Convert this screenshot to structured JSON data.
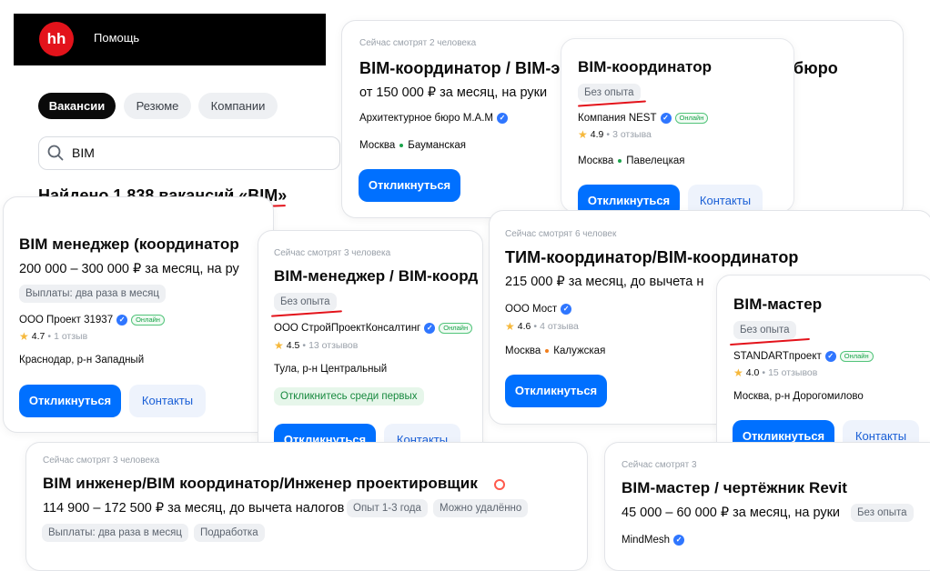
{
  "header": {
    "logo": "hh",
    "help": "Помощь"
  },
  "tabs": [
    {
      "label": "Вакансии"
    },
    {
      "label": "Резюме"
    },
    {
      "label": "Компании"
    }
  ],
  "search": {
    "value": "BIM"
  },
  "found": "Найдено 1 838 вакансий «BIM»",
  "cards": {
    "c1": {
      "viewers": "Сейчас смотрят 2 человека",
      "title": "BIM-координатор / BIM-эн",
      "salary": "от 150 000 ₽ за месяц, на руки",
      "company": "Архитектурное бюро М.А.М",
      "city": "Москва",
      "metro": "Бауманская",
      "apply": "Откликнуться",
      "ghost": "бюро"
    },
    "c2": {
      "title": "BIM-координатор",
      "experience": "Без опыта",
      "company": "Компания NEST",
      "online": "Онлайн",
      "rating": "4.9",
      "reviews": "3 отзыва",
      "city": "Москва",
      "metro": "Павелецкая",
      "apply": "Откликнуться",
      "contacts": "Контакты"
    },
    "c3": {
      "title": "BIM менеджер (координатор",
      "salary": "200 000 – 300 000 ₽ за месяц, на ру",
      "payments": "Выплаты: два раза в месяц",
      "company": "ООО Проект 31937",
      "online": "Онлайн",
      "rating": "4.7",
      "reviews": "1 отзыв",
      "location": "Краснодар, р-н Западный",
      "apply": "Откликнуться",
      "contacts": "Контакты"
    },
    "c4": {
      "viewers": "Сейчас смотрят 3 человека",
      "title": "BIM-менеджер / BIM-коорд",
      "experience": "Без опыта",
      "company": "ООО СтройПроектКонсалтинг",
      "online": "Онлайн",
      "rating": "4.5",
      "reviews": "13 отзывов",
      "location": "Тула, р-н Центральный",
      "badge": "Откликнитесь среди первых",
      "apply": "Откликнуться",
      "contacts": "Контакты"
    },
    "c5": {
      "viewers": "Сейчас смотрят 6 человек",
      "title": "ТИМ-координатор/BIM-координатор",
      "salary": "215 000 ₽ за месяц, до вычета н",
      "company": "ООО Мост",
      "rating": "4.6",
      "reviews": "4 отзыва",
      "city": "Москва",
      "metro": "Калужская",
      "apply": "Откликнуться"
    },
    "c6": {
      "title": "BIM-мастер",
      "experience": "Без опыта",
      "company": "STANDARTпроект",
      "online": "Онлайн",
      "rating": "4.0",
      "reviews": "15 отзывов",
      "location": "Москва, р-н Дорогомилово",
      "apply": "Откликнуться",
      "contacts": "Контакты"
    },
    "c7": {
      "viewers": "Сейчас смотрят 3 человека",
      "title": "BIM инженер/BIM координатор/Инженер проектировщик",
      "salary": "114 900 – 172 500 ₽ за месяц, до вычета налогов",
      "experience": "Опыт 1-3 года",
      "remote": "Можно удалённо",
      "payments": "Выплаты: два раза в месяц",
      "parttime": "Подработка"
    },
    "c8": {
      "viewers": "Сейчас смотрят 3",
      "title": "BIM-мастер / чертёжник Revit",
      "salary": "45 000 – 60 000 ₽ за месяц, на руки",
      "experience": "Без опыта",
      "company": "MindMesh"
    }
  },
  "colors": {
    "accent": "#0070ff",
    "brand": "#e3131b",
    "metro_bauman": "#1aa34a",
    "metro_pavelets": "#1aa34a",
    "metro_kaluzh": "#f07e1b"
  },
  "icons": {
    "search": "search-icon",
    "verified": "verified-icon",
    "star": "star-icon"
  }
}
